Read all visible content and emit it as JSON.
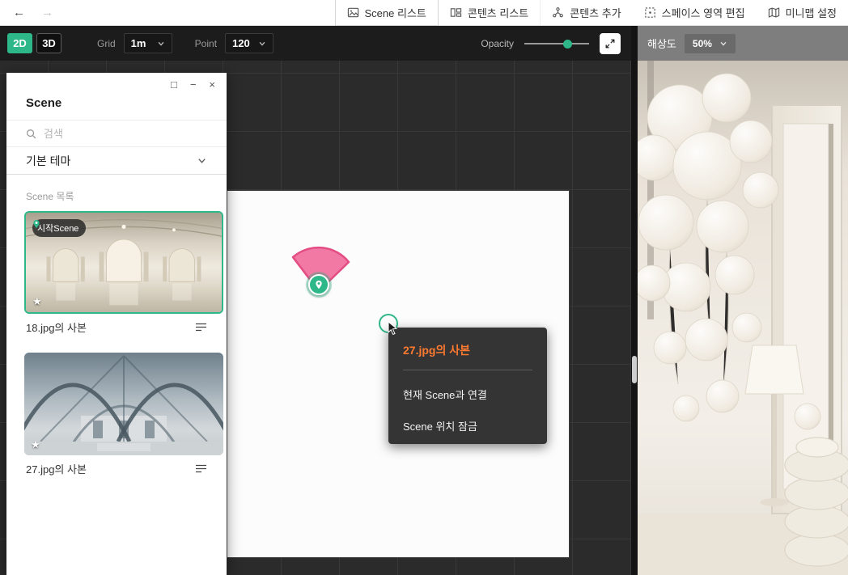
{
  "topbar": {
    "back_icon": "←",
    "forward_icon": "→",
    "tabs": [
      {
        "label": "Scene 리스트"
      },
      {
        "label": "콘텐츠 리스트"
      },
      {
        "label": "콘텐츠 추가"
      },
      {
        "label": "스페이스 영역 편집"
      },
      {
        "label": "미니맵 설정"
      }
    ]
  },
  "toolbar": {
    "mode_2d": "2D",
    "mode_3d": "3D",
    "grid_label": "Grid",
    "grid_value": "1m",
    "point_label": "Point",
    "point_value": "120",
    "opacity_label": "Opacity",
    "opacity_percent": 60
  },
  "preview": {
    "resolution_label": "해상도",
    "resolution_value": "50%"
  },
  "panel": {
    "title": "Scene",
    "search_placeholder": "검색",
    "theme": "기본 테마",
    "section": "Scene 목록",
    "scenes": [
      {
        "name": "18.jpg의 사본",
        "badge": "시작Scene",
        "selected": true
      },
      {
        "name": "27.jpg의 사본",
        "selected": false
      }
    ]
  },
  "context_menu": {
    "title": "27.jpg의 사본",
    "items": [
      {
        "label": "현재 Scene과 연결"
      },
      {
        "label": "Scene 위치 잠금"
      }
    ]
  },
  "icons": {
    "maximize": "□",
    "minimize": "−",
    "close": "×",
    "star": "★"
  },
  "colors": {
    "accent_green": "#2eb889",
    "fov_pink": "#f2729f",
    "fov_pink_border": "#e2447e",
    "menu_title_orange": "#ff7a30"
  }
}
